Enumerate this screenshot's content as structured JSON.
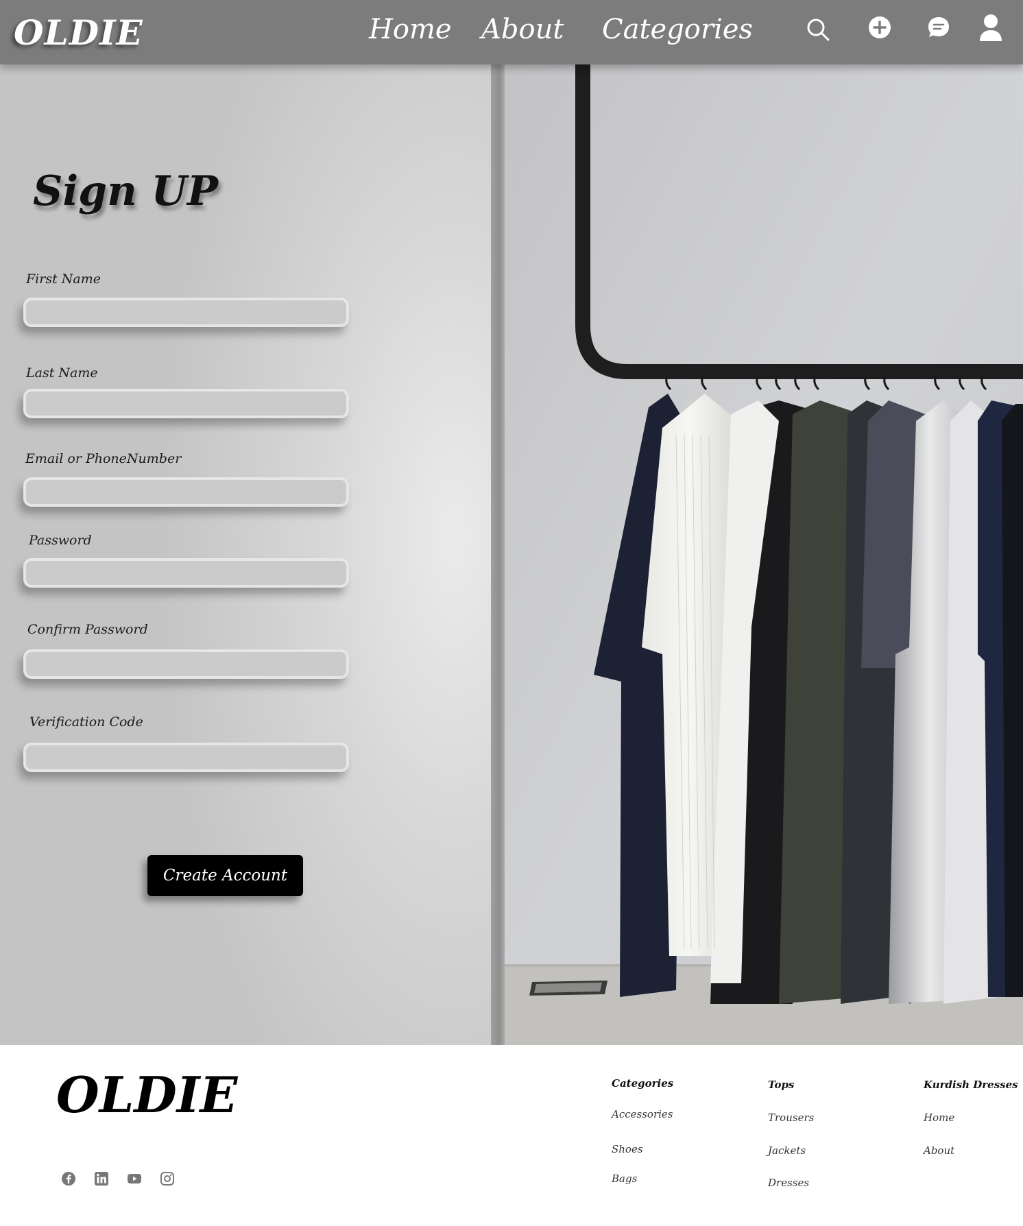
{
  "header": {
    "logo": "OLDIE",
    "nav": {
      "home": "Home",
      "about": "About",
      "categories": "Categories"
    },
    "icons": [
      "search-icon",
      "add-circle-icon",
      "chat-icon",
      "user-icon"
    ]
  },
  "form": {
    "title": "Sign UP",
    "fields": [
      {
        "label": "First Name",
        "value": "",
        "placeholder": ""
      },
      {
        "label": "Last Name",
        "value": "",
        "placeholder": ""
      },
      {
        "label": "Email or PhoneNumber",
        "value": "",
        "placeholder": ""
      },
      {
        "label": "Password",
        "value": "",
        "placeholder": ""
      },
      {
        "label": "Confirm Password",
        "value": "",
        "placeholder": ""
      },
      {
        "label": "Verification Code",
        "value": "",
        "placeholder": ""
      }
    ],
    "submit_label": "Create Account"
  },
  "footer": {
    "logo": "OLDIE",
    "social_icons": [
      "facebook-icon",
      "linkedin-icon",
      "youtube-icon",
      "instagram-icon"
    ],
    "columns": [
      {
        "heading": "Categories",
        "links": [
          "Accessories",
          "Shoes",
          "Bags"
        ]
      },
      {
        "heading": "Tops",
        "links": [
          "Trousers",
          "Jackets",
          "Dresses"
        ]
      },
      {
        "heading": "Kurdish Dresses",
        "links": [
          "Home",
          "About"
        ]
      }
    ]
  },
  "colors": {
    "header_bg": "#7c7c7c",
    "button_bg": "#000000",
    "footer_bg": "#ffffff",
    "text_dark": "#111111"
  }
}
